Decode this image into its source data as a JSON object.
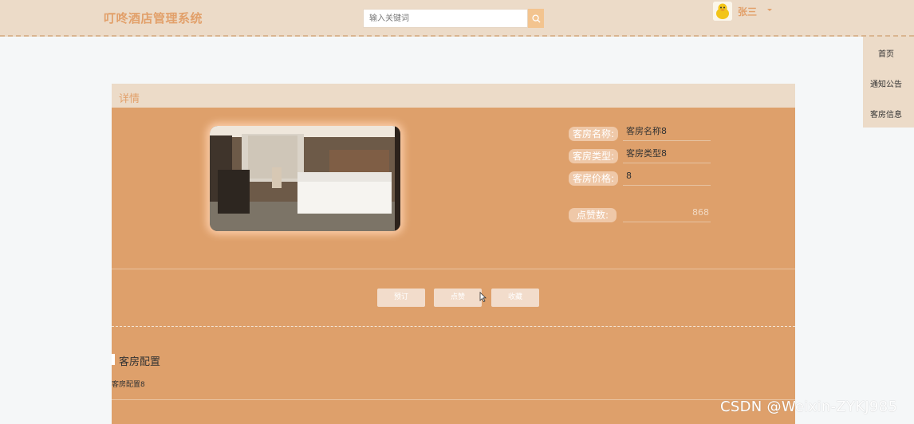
{
  "header": {
    "logo": "叮咚酒店管理系统",
    "search": {
      "placeholder": "输入关键词"
    },
    "user": {
      "name": "张三"
    }
  },
  "side_nav": {
    "items": [
      {
        "label": "首页"
      },
      {
        "label": "通知公告"
      },
      {
        "label": "客房信息"
      }
    ]
  },
  "detail": {
    "title": "详情",
    "fields": [
      {
        "label": "客房名称:",
        "value": "客房名称8"
      },
      {
        "label": "客房类型:",
        "value": "客房类型8"
      },
      {
        "label": "客房价格:",
        "value": "8"
      }
    ],
    "likes": {
      "label": "点赞数:",
      "value": "868"
    },
    "buttons": {
      "book": "预订",
      "like": "点赞",
      "favorite": "收藏"
    }
  },
  "config": {
    "title": "客房配置",
    "text": "客房配置8"
  },
  "watermark": "CSDN @Weixin-ZYKJ985",
  "colors": {
    "header_bg": "#ecdbc8",
    "accent": "#e2a06a",
    "panel_bg": "#dea06b",
    "search_button": "#f3c48f"
  },
  "icons": {
    "search": "search-icon",
    "avatar": "avatar"
  }
}
